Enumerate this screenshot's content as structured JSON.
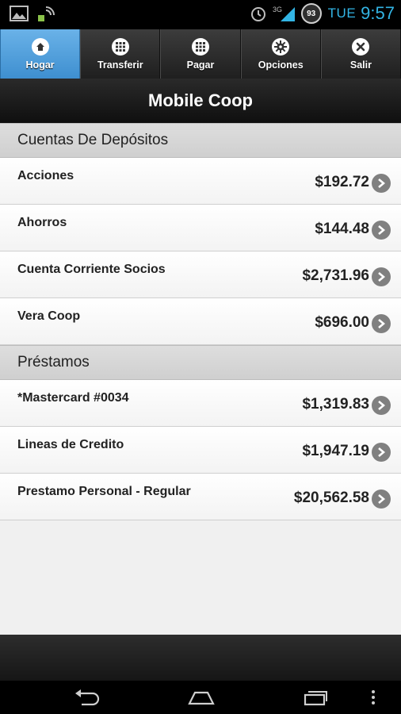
{
  "status_bar": {
    "network": "3G",
    "battery": "93",
    "day": "TUE",
    "time": "9:57",
    "icons": [
      "image-icon",
      "wifi-icon",
      "alarm-icon",
      "signal-icon",
      "battery-icon"
    ]
  },
  "tabs": [
    {
      "label": "Hogar",
      "icon": "home-icon",
      "active": true
    },
    {
      "label": "Transferir",
      "icon": "grid-icon",
      "active": false
    },
    {
      "label": "Pagar",
      "icon": "grid-icon",
      "active": false
    },
    {
      "label": "Opciones",
      "icon": "gear-icon",
      "active": false
    },
    {
      "label": "Salir",
      "icon": "close-icon",
      "active": false
    }
  ],
  "header": {
    "title": "Mobile Coop"
  },
  "sections": [
    {
      "title": "Cuentas De Depósitos",
      "rows": [
        {
          "label": "Acciones",
          "amount": "$192.72"
        },
        {
          "label": "Ahorros",
          "amount": "$144.48"
        },
        {
          "label": "Cuenta Corriente Socios",
          "amount": "$2,731.96"
        },
        {
          "label": "Vera Coop",
          "amount": "$696.00"
        }
      ]
    },
    {
      "title": "Préstamos",
      "rows": [
        {
          "label": "*Mastercard #0034",
          "amount": "$1,319.83"
        },
        {
          "label": "Lineas de Credito",
          "amount": "$1,947.19"
        },
        {
          "label": "Prestamo Personal - Regular",
          "amount": "$20,562.58"
        }
      ]
    }
  ],
  "colors": {
    "accent": "#33b5e5",
    "active_tab": "#4f9fdc",
    "chevron": "#808080"
  },
  "nav": [
    "back-icon",
    "home-icon",
    "recents-icon",
    "menu-icon"
  ]
}
